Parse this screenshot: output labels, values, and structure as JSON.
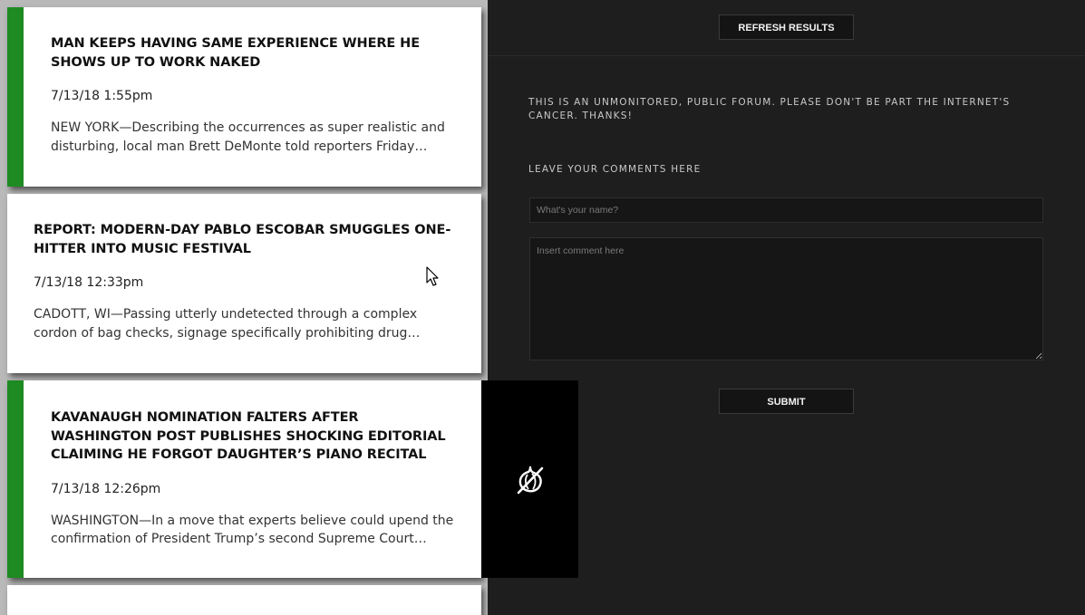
{
  "articles": [
    {
      "title": "MAN KEEPS HAVING SAME EXPERIENCE WHERE HE SHOWS UP TO WORK NAKED",
      "date": "7/13/18 1:55pm",
      "excerpt": "NEW YORK—Describing the occurrences as super realistic and disturbing, local man Brett DeMonte told reporters Friday…"
    },
    {
      "title": "REPORT: MODERN-DAY PABLO ESCOBAR SMUGGLES ONE-HITTER INTO MUSIC FESTIVAL",
      "date": "7/13/18 12:33pm",
      "excerpt": "CADOTT, WI—Passing utterly undetected through a complex cordon of bag checks, signage specifically prohibiting drug…"
    },
    {
      "title": "KAVANAUGH NOMINATION FALTERS AFTER WASHINGTON POST PUBLISHES SHOCKING EDITORIAL CLAIMING HE FORGOT DAUGHTER’S PIANO RECITAL",
      "date": "7/13/18 12:26pm",
      "excerpt": "WASHINGTON—In a move that experts believe could upend the confirmation of President Trump’s second Supreme Court…"
    }
  ],
  "forum": {
    "refresh_label": "REFRESH RESULTS",
    "notice": "THIS IS AN UNMONITORED, PUBLIC FORUM. PLEASE DON'T BE PART THE INTERNET'S CANCER. THANKS!",
    "leave_label": "LEAVE YOUR COMMENTS HERE",
    "name_placeholder": "What's your name?",
    "comment_placeholder": "Insert comment here",
    "submit_label": "SUBMIT"
  },
  "icons": {
    "logo": "onion-logo-icon",
    "cursor": "mouse-pointer-icon"
  },
  "colors": {
    "accent_green": "#1e8a22",
    "panel_bg": "#1e1e1e",
    "card_bg": "#ffffff",
    "logo_bg": "#000000"
  }
}
